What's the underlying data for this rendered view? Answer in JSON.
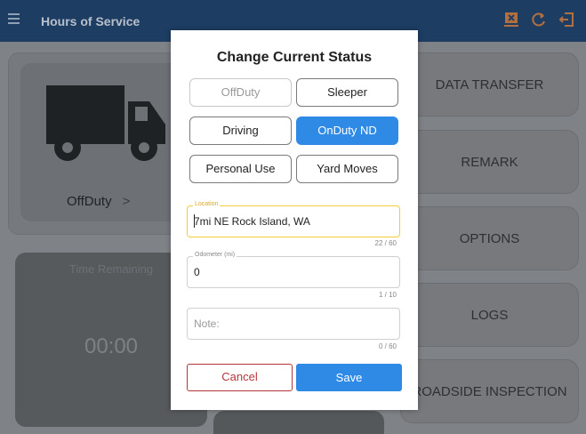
{
  "topbar": {
    "title": "Hours of Service",
    "icons": [
      "menu-icon",
      "export-icon",
      "refresh-icon",
      "logout-icon"
    ]
  },
  "status_card": {
    "status": "OffDuty",
    "chevron": ">"
  },
  "time_card": {
    "label": "Time Remaining",
    "time": "00:00"
  },
  "right_menu": [
    "DATA TRANSFER",
    "REMARK",
    "OPTIONS",
    "LOGS",
    "ROADSIDE INSPECTION"
  ],
  "dialog": {
    "title": "Change Current Status",
    "status_buttons": {
      "offduty": "OffDuty",
      "sleeper": "Sleeper",
      "driving": "Driving",
      "onduty_nd": "OnDuty ND",
      "personal_use": "Personal Use",
      "yard_moves": "Yard Moves"
    },
    "selected_status": "OnDuty ND",
    "location": {
      "label": "Location",
      "value": "7mi NE Rock Island, WA",
      "counter": "22 / 60"
    },
    "odometer": {
      "label": "Odometer (mi)",
      "value": "0",
      "counter": "1 / 10"
    },
    "note": {
      "placeholder": "Note:",
      "counter": "0 / 60"
    },
    "cancel_label": "Cancel",
    "save_label": "Save"
  },
  "colors": {
    "topbar": "#1e3d63",
    "accent_blue": "#2f8ae6",
    "cancel_red": "#b5353c",
    "focus_yellow": "#f3cc3d",
    "icon_orange": "#b3703f"
  }
}
